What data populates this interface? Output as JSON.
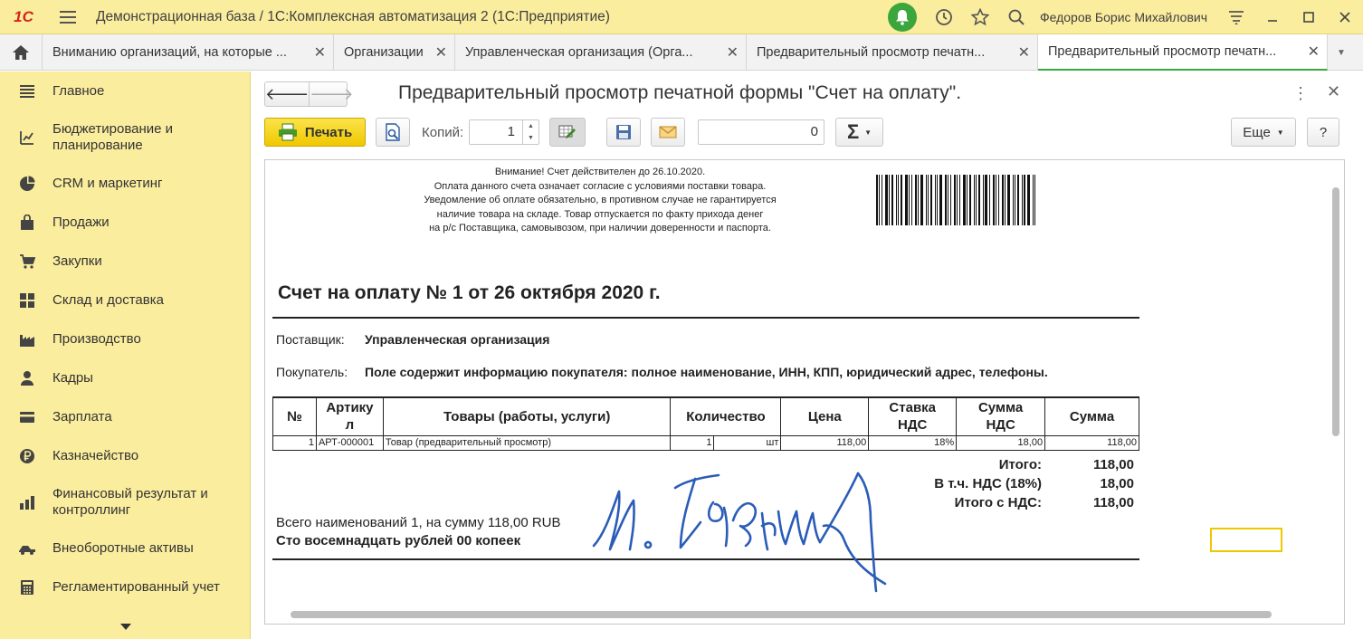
{
  "titlebar": {
    "logo": "1С",
    "title": "Демонстрационная база / 1С:Комплексная автоматизация 2  (1С:Предприятие)",
    "user": "Федоров Борис Михайлович"
  },
  "tabs": [
    {
      "label": "Вниманию организаций, на которые ..."
    },
    {
      "label": "Организации"
    },
    {
      "label": "Управленческая организация (Орга..."
    },
    {
      "label": "Предварительный просмотр печатн..."
    },
    {
      "label": "Предварительный просмотр печатн..."
    }
  ],
  "sidebar": {
    "items": [
      {
        "label": "Главное",
        "icon": "menu-icon"
      },
      {
        "label": "Бюджетирование и планирование",
        "icon": "budget-icon"
      },
      {
        "label": "CRM и маркетинг",
        "icon": "pie-icon"
      },
      {
        "label": "Продажи",
        "icon": "bag-icon"
      },
      {
        "label": "Закупки",
        "icon": "cart-icon"
      },
      {
        "label": "Склад и доставка",
        "icon": "warehouse-icon"
      },
      {
        "label": "Производство",
        "icon": "factory-icon"
      },
      {
        "label": "Кадры",
        "icon": "person-icon"
      },
      {
        "label": "Зарплата",
        "icon": "card-icon"
      },
      {
        "label": "Казначейство",
        "icon": "ruble-icon"
      },
      {
        "label": "Финансовый результат и контроллинг",
        "icon": "finance-icon"
      },
      {
        "label": "Внеоборотные активы",
        "icon": "truck-icon"
      },
      {
        "label": "Регламентированный учет",
        "icon": "calculator-icon"
      }
    ]
  },
  "form": {
    "title": "Предварительный просмотр печатной формы \"Счет на оплату\".",
    "print_label": "Печать",
    "copies_label": "Копий:",
    "copies_value": "1",
    "sum_value": "0",
    "more_label": "Еще",
    "help_label": "?"
  },
  "document": {
    "notice": [
      "Внимание! Счет действителен до 26.10.2020.",
      "Оплата данного счета означает согласие с условиями поставки товара.",
      "Уведомление об оплате обязательно, в противном случае не гарантируется",
      "наличие товара на складе. Товар отпускается по факту прихода денег",
      "на р/с Поставщика, самовывозом, при наличии доверенности и паспорта."
    ],
    "title": "Счет на оплату № 1 от 26 октября 2020 г.",
    "supplier_label": "Поставщик:",
    "supplier_value": "Управленческая организация",
    "buyer_label": "Покупатель:",
    "buyer_value": "Поле содержит информацию покупателя: полное наименование, ИНН, КПП, юридический адрес, телефоны.",
    "table_headers": [
      "№",
      "Артикул",
      "Товары (работы, услуги)",
      "Количество",
      "Цена",
      "Ставка НДС",
      "Сумма НДС",
      "Сумма"
    ],
    "rows": [
      {
        "num": "1",
        "sku": "АРТ-000001",
        "name": "Товар (предварительный просмотр)",
        "qty": "1",
        "unit": "шт",
        "price": "118,00",
        "vat_rate": "18%",
        "vat_sum": "18,00",
        "sum": "118,00"
      }
    ],
    "totals": [
      {
        "label": "Итого:",
        "value": "118,00"
      },
      {
        "label": "В т.ч. НДС (18%)",
        "value": "18,00"
      },
      {
        "label": "Итого с НДС:",
        "value": "118,00"
      }
    ],
    "summary_line": "Всего наименований 1, на сумму 118,00 RUB",
    "amount_words": "Сто восемнадцать рублей 00 копеек"
  }
}
